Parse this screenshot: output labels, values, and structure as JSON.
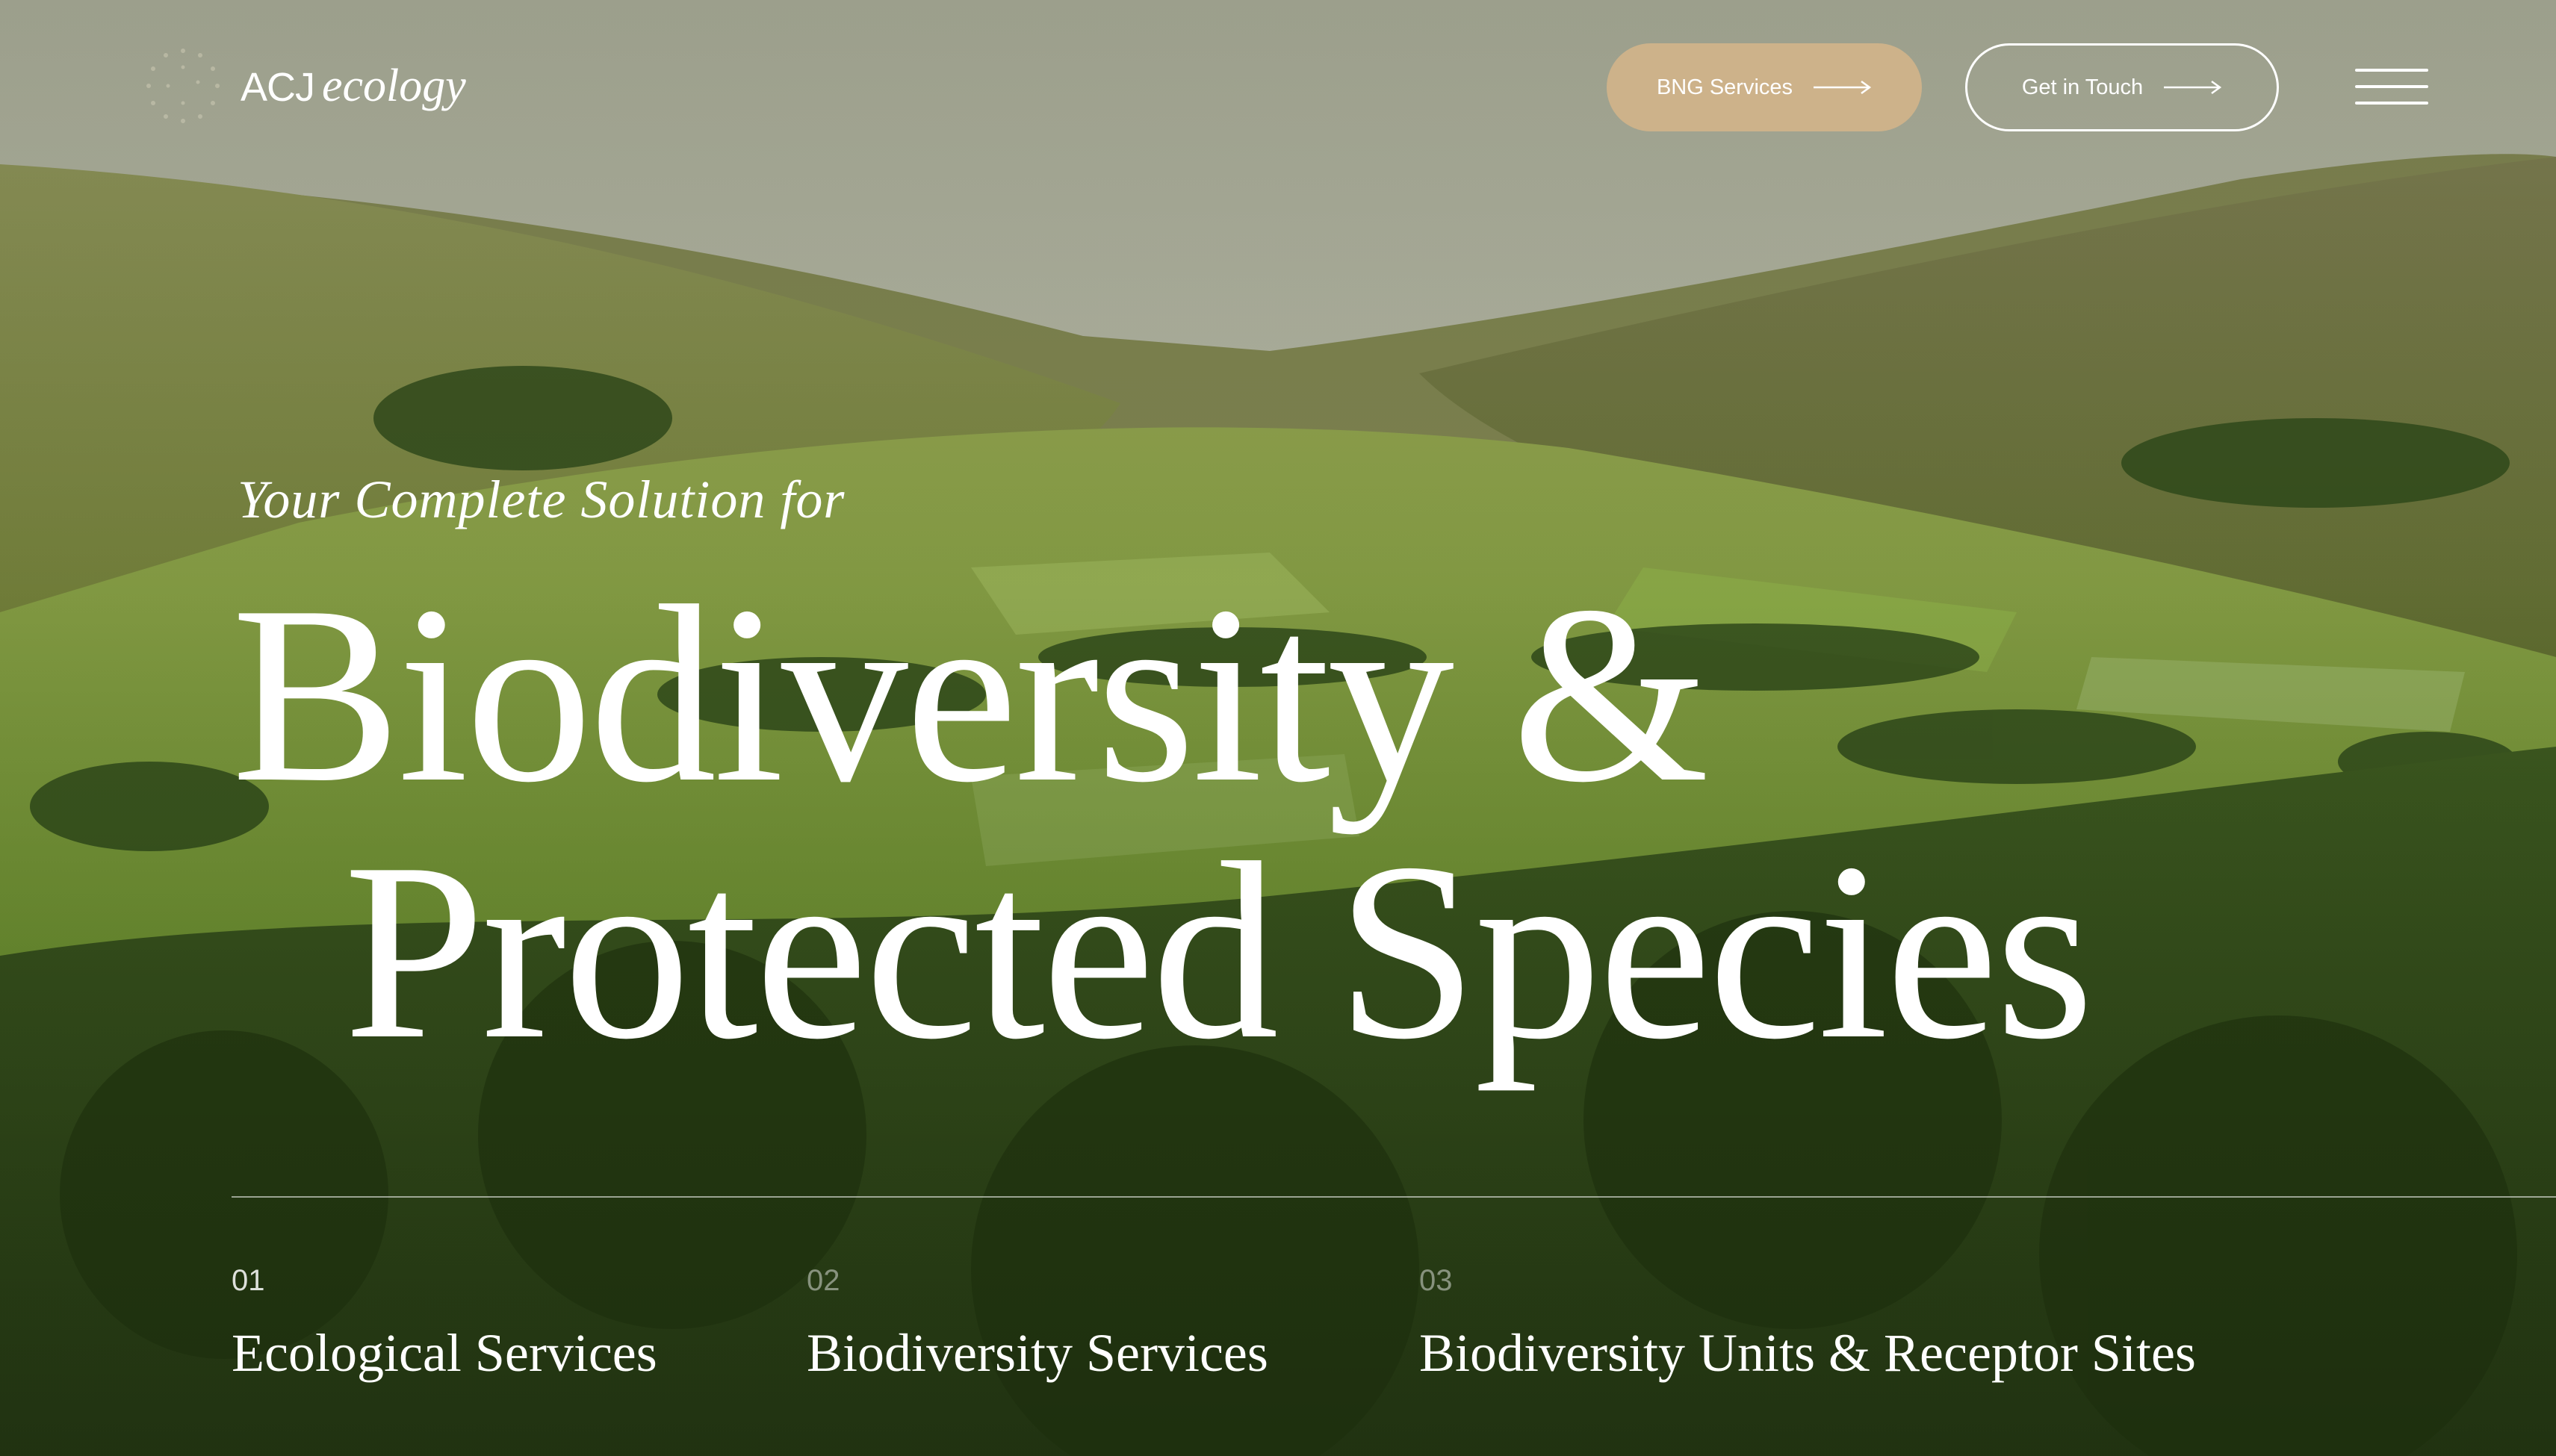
{
  "header": {
    "logo": {
      "brand": "ACJ",
      "wordmark": "ecology",
      "icon": "dotted-circle-logo-icon"
    },
    "buttons": {
      "bng_label": "BNG Services",
      "contact_label": "Get in Touch",
      "arrow_icon": "long-arrow-right-icon"
    },
    "menu_icon": "hamburger-menu-icon"
  },
  "hero": {
    "kicker": "Your Complete Solution for",
    "title_line1": "Biodiversity &",
    "title_line2": "Protected Species",
    "background": "aerial-valley-landscape"
  },
  "services": [
    {
      "number": "01",
      "title": "Ecological Services"
    },
    {
      "number": "02",
      "title": "Biodiversity Services"
    },
    {
      "number": "03",
      "title": "Biodiversity Units & Receptor Sites"
    }
  ],
  "colors": {
    "accent_button": "#cdb28a",
    "text": "#ffffff"
  }
}
